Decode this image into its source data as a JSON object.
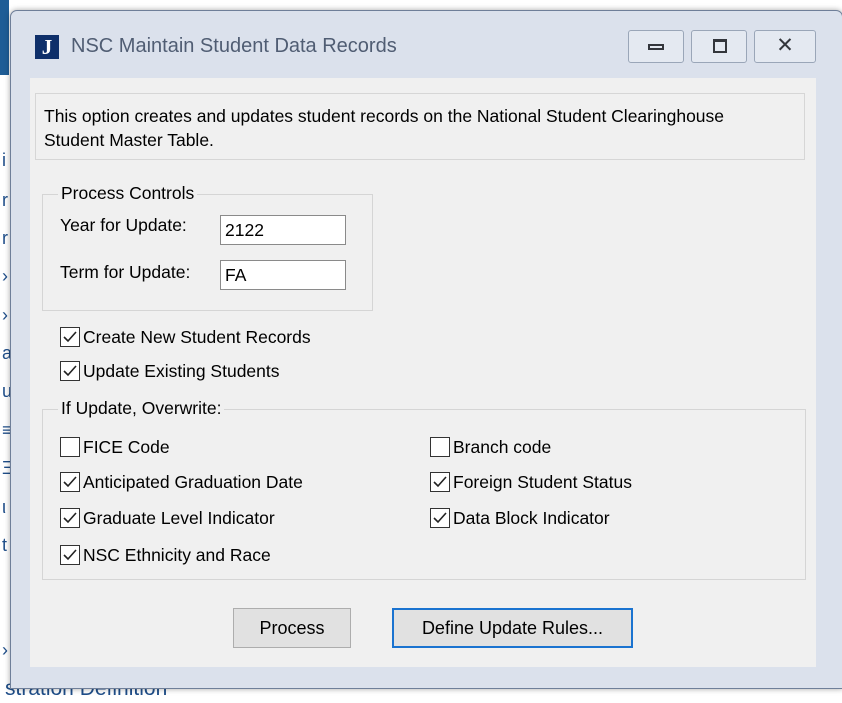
{
  "window": {
    "title": "NSC Maintain Student Data Records",
    "icon_letter": "J",
    "close_glyph": "✕"
  },
  "description": "This option creates and updates student records on the National Student Clearinghouse Student Master Table.",
  "process_controls": {
    "legend": "Process Controls",
    "year_label": "Year for Update:",
    "year_value": "2122",
    "term_label": "Term for Update:",
    "term_value": "FA"
  },
  "options": {
    "create_new": {
      "label": "Create New Student Records",
      "checked": true
    },
    "update_existing": {
      "label": "Update Existing Students",
      "checked": true
    }
  },
  "overwrite": {
    "legend": "If Update, Overwrite:",
    "items": [
      {
        "label": "FICE Code",
        "checked": false
      },
      {
        "label": "Branch code",
        "checked": false
      },
      {
        "label": "Anticipated Graduation Date",
        "checked": true
      },
      {
        "label": "Foreign Student Status",
        "checked": true
      },
      {
        "label": "Graduate Level Indicator",
        "checked": true
      },
      {
        "label": "Data Block Indicator",
        "checked": true
      },
      {
        "label": "NSC Ethnicity and Race",
        "checked": true
      }
    ]
  },
  "buttons": {
    "process": "Process",
    "define_rules": "Define Update Rules..."
  },
  "background": {
    "side_letters": [
      "i",
      "r",
      "r",
      "›",
      "›",
      "a",
      "u",
      "≡",
      "Ξ",
      "ι",
      "t",
      "›"
    ],
    "bottom_text": "stration Definition"
  }
}
